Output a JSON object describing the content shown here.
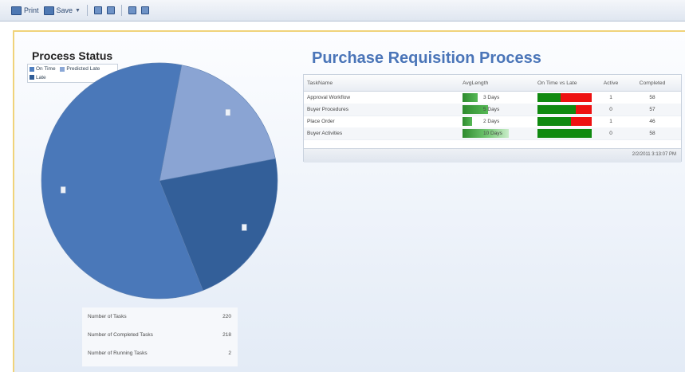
{
  "toolbar": {
    "print_label": "Print",
    "save_label": "Save",
    "icons": [
      "print-icon",
      "save-icon",
      "page-icon",
      "page-icon-2",
      "export-icon",
      "folder-icon"
    ]
  },
  "process_status": {
    "title": "Process Status",
    "legend": [
      {
        "label": "On Time",
        "color": "#4f7fc0"
      },
      {
        "label": "Predicted Late",
        "color": "#8aa7d6"
      },
      {
        "label": "Late",
        "color": "#2f5c96"
      }
    ],
    "pie_colors": [
      "#4a78b9",
      "#8aa4d3",
      "#335f99"
    ]
  },
  "chart_data": {
    "type": "pie",
    "categories": [
      "On Time",
      "Predicted Late",
      "Late"
    ],
    "values": [
      59,
      19,
      22
    ],
    "title": "Process Status"
  },
  "stats": [
    {
      "label": "Number of Tasks",
      "value": "220"
    },
    {
      "label": "Number of Completed Tasks",
      "value": "218"
    },
    {
      "label": "Number of Running Tasks",
      "value": "2"
    }
  ],
  "requisition": {
    "title": "Purchase Requisition Process",
    "columns": [
      "TaskName",
      "AvgLength",
      "On Time vs Late",
      "Active",
      "Completed"
    ],
    "rows": [
      {
        "name": "Approval Workflow",
        "avg": "3 Days",
        "avg_frac": 0.32,
        "ontime": 0.42,
        "active": "1",
        "completed": "58"
      },
      {
        "name": "Buyer Procedures",
        "avg": "5 Days",
        "avg_frac": 0.55,
        "ontime": 0.7,
        "active": "0",
        "completed": "57"
      },
      {
        "name": "Place Order",
        "avg": "2 Days",
        "avg_frac": 0.2,
        "ontime": 0.62,
        "active": "1",
        "completed": "46"
      },
      {
        "name": "Buyer Activities",
        "avg": "10 Days",
        "avg_frac": 1.0,
        "ontime": 1.0,
        "active": "0",
        "completed": "58"
      }
    ],
    "timestamp": "2/2/2011 3:13:07 PM"
  }
}
